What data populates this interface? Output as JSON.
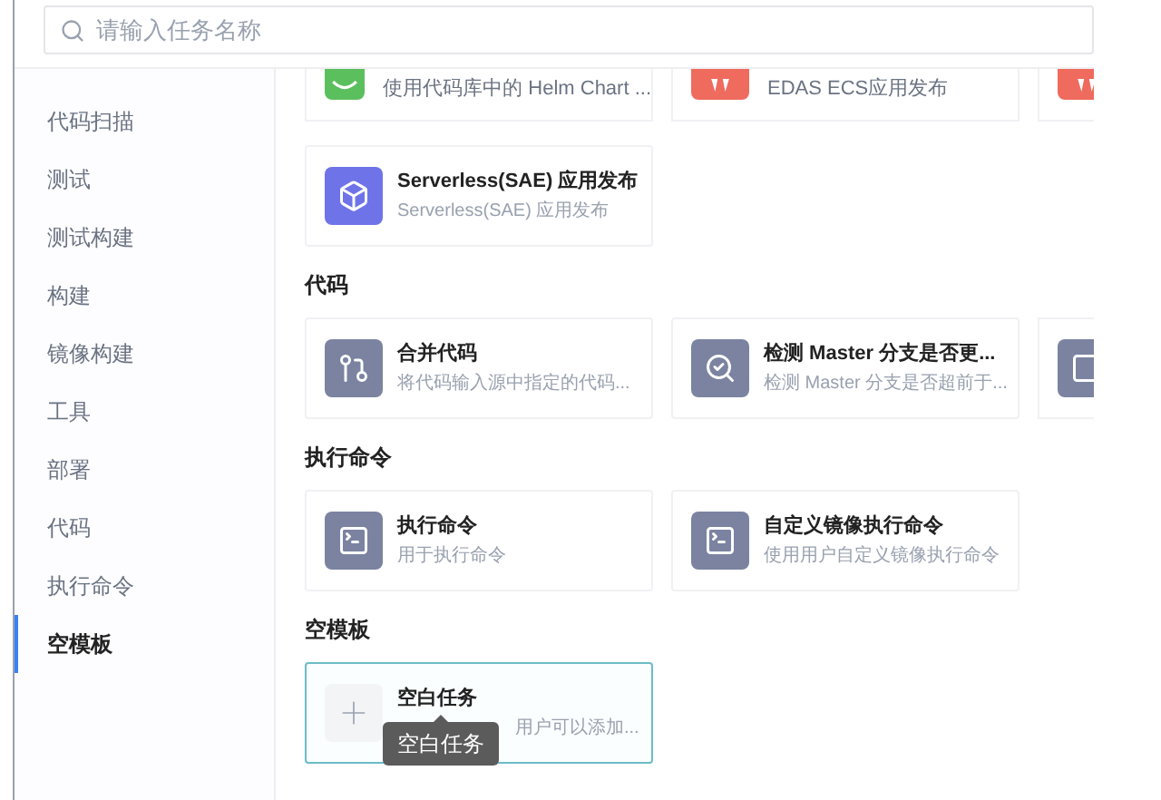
{
  "search": {
    "placeholder": "请输入任务名称"
  },
  "sidebar": {
    "items": [
      {
        "label": "代码扫描",
        "selected": false
      },
      {
        "label": "测试",
        "selected": false
      },
      {
        "label": "测试构建",
        "selected": false
      },
      {
        "label": "构建",
        "selected": false
      },
      {
        "label": "镜像构建",
        "selected": false
      },
      {
        "label": "工具",
        "selected": false
      },
      {
        "label": "部署",
        "selected": false
      },
      {
        "label": "代码",
        "selected": false
      },
      {
        "label": "执行命令",
        "selected": false
      },
      {
        "label": "空模板",
        "selected": true
      }
    ]
  },
  "sections": [
    {
      "rows": [
        [
          {
            "kind": "clipped-top",
            "description": "使用代码库中的 Helm Chart ...",
            "color": "#5cbf5e"
          },
          {
            "kind": "clipped-top",
            "description": "EDAS ECS应用发布",
            "color": "#ee6b5e"
          },
          {
            "kind": "clipped-corner",
            "color": "#ee6b5e"
          }
        ],
        [
          {
            "kind": "full",
            "title": "Serverless(SAE) 应用发布",
            "description": "Serverless(SAE) 应用发布",
            "color": "#6e74e8"
          }
        ]
      ]
    },
    {
      "heading": "代码",
      "rows": [
        [
          {
            "kind": "full",
            "title": "合并代码",
            "description": "将代码输入源中指定的代码...",
            "color": "#7b83a1"
          },
          {
            "kind": "full",
            "title": "检测 Master 分支是否更...",
            "description": "检测 Master 分支是否超前于...",
            "color": "#7b83a1"
          },
          {
            "kind": "clipped-right",
            "color": "#7b83a1"
          }
        ]
      ]
    },
    {
      "heading": "执行命令",
      "rows": [
        [
          {
            "kind": "full",
            "title": "执行命令",
            "description": "用于执行命令",
            "color": "#7b83a1"
          },
          {
            "kind": "full",
            "title": "自定义镜像执行命令",
            "description": "使用用户自定义镜像执行命令",
            "color": "#7b83a1"
          }
        ]
      ]
    },
    {
      "heading": "空模板",
      "rows": [
        [
          {
            "kind": "blank",
            "title": "空白任务",
            "description": "用户可以添加...",
            "color": "#f3f4f6",
            "selected": true,
            "tooltip": "空白任务"
          }
        ]
      ]
    }
  ]
}
